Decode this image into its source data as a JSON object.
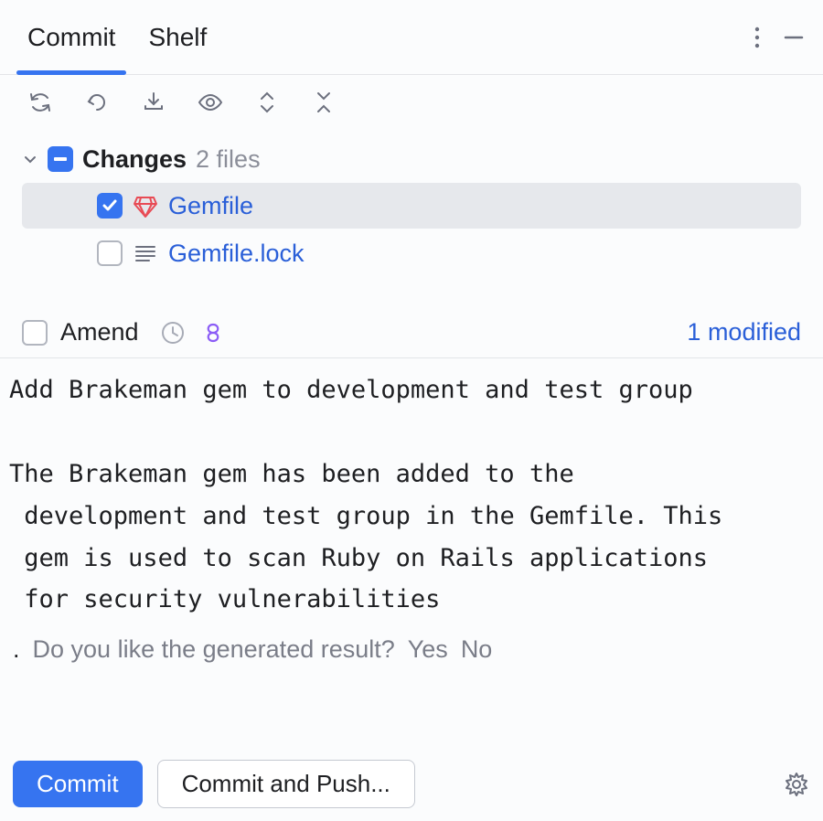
{
  "tabs": {
    "commit": "Commit",
    "shelf": "Shelf"
  },
  "changes": {
    "title": "Changes",
    "count": "2 files"
  },
  "files": [
    {
      "name": "Gemfile",
      "checked": true,
      "icon": "ruby"
    },
    {
      "name": "Gemfile.lock",
      "checked": false,
      "icon": "text"
    }
  ],
  "amend": {
    "label": "Amend"
  },
  "status": {
    "modified": "1 modified"
  },
  "message": "Add Brakeman gem to development and test group\n\nThe Brakeman gem has been added to the\n development and test group in the Gemfile. This\n gem is used to scan Ruby on Rails applications\n for security vulnerabilities",
  "feedback": {
    "prompt": "Do you like the generated result?",
    "yes": "Yes",
    "no": "No"
  },
  "buttons": {
    "commit": "Commit",
    "commit_push": "Commit and Push..."
  }
}
